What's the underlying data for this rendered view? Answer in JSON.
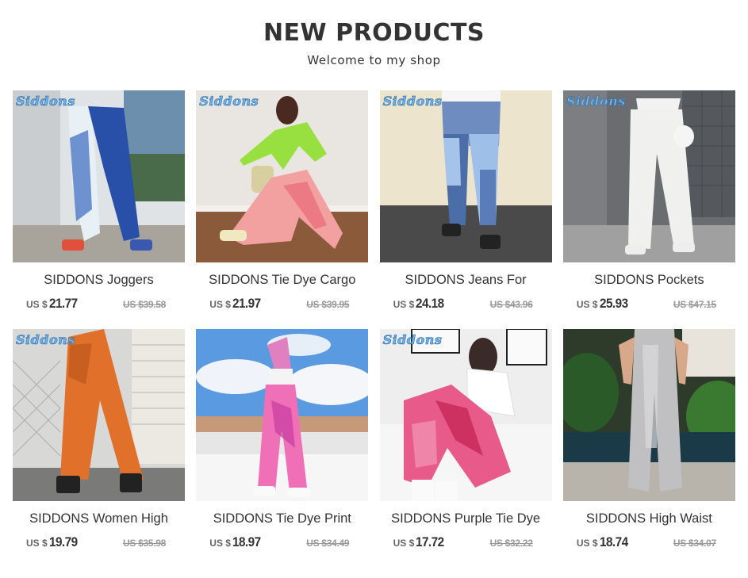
{
  "header": {
    "title": "NEW PRODUCTS",
    "subtitle": "Welcome to my shop"
  },
  "products": [
    {
      "name": "SIDDONS Joggers",
      "currency": "US $",
      "price": "21.77",
      "old_price": "US $39.58",
      "watermark": "Siddons",
      "image": "tie-dye-jogger-photo"
    },
    {
      "name": "SIDDONS Tie Dye Cargo",
      "currency": "US $",
      "price": "21.97",
      "old_price": "US $39.95",
      "watermark": "Siddons",
      "image": "pink-cargo-photo"
    },
    {
      "name": "SIDDONS Jeans For",
      "currency": "US $",
      "price": "24.18",
      "old_price": "US $43.96",
      "watermark": "Siddons",
      "image": "patchwork-jeans-photo"
    },
    {
      "name": "SIDDONS Pockets",
      "currency": "US $",
      "price": "25.93",
      "old_price": "US $47.15",
      "watermark": "Siddons",
      "image": "white-pants-photo"
    },
    {
      "name": "SIDDONS Women High",
      "currency": "US $",
      "price": "19.79",
      "old_price": "US $35.98",
      "watermark": "Siddons",
      "image": "orange-jogger-photo"
    },
    {
      "name": "SIDDONS Tie Dye Print",
      "currency": "US $",
      "price": "18.97",
      "old_price": "US $34.49",
      "watermark": "",
      "image": "pink-tie-dye-photo"
    },
    {
      "name": "SIDDONS Purple Tie Dye",
      "currency": "US $",
      "price": "17.72",
      "old_price": "US $32.22",
      "watermark": "Siddons",
      "image": "red-tie-dye-photo"
    },
    {
      "name": "SIDDONS High Waist",
      "currency": "US $",
      "price": "18.74",
      "old_price": "US $34.07",
      "watermark": "",
      "image": "grey-wide-leg-photo"
    }
  ]
}
